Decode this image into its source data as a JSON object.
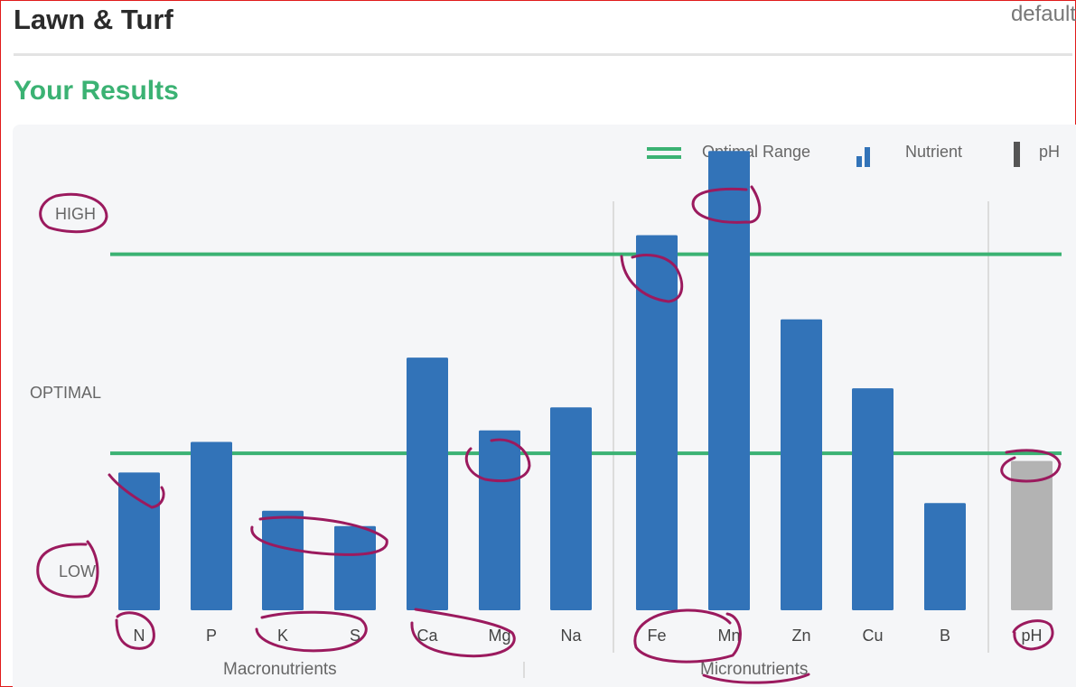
{
  "header": {
    "title": "Lawn & Turf",
    "profile": "default"
  },
  "section": {
    "title": "Your Results"
  },
  "legend": {
    "optimal": "Optimal Range",
    "nutrient": "Nutrient",
    "ph": "pH"
  },
  "levels": {
    "high": "HIGH",
    "optimal": "OPTIMAL",
    "low": "LOW"
  },
  "groups": {
    "macro": "Macronutrients",
    "micro": "Micronutrients"
  },
  "colors": {
    "nutrient": "#3273b8",
    "ph": "#b3b3b3",
    "optimal": "#3bb273",
    "annotation": "#9b1a5e"
  },
  "chart_data": {
    "type": "bar",
    "categories": [
      "N",
      "P",
      "K",
      "S",
      "Ca",
      "Mg",
      "Na",
      "Fe",
      "Mn",
      "Zn",
      "Cu",
      "B",
      "pH"
    ],
    "values": [
      0.36,
      0.44,
      0.26,
      0.22,
      0.66,
      0.47,
      0.53,
      0.98,
      1.2,
      0.76,
      0.58,
      0.28,
      0.39
    ],
    "ylim": [
      0,
      1.25
    ],
    "y_levels": [
      "LOW",
      "OPTIMAL",
      "HIGH"
    ],
    "optimal_range": [
      0.41,
      0.93
    ],
    "groups": [
      {
        "name": "Macronutrients",
        "categories": [
          "N",
          "P",
          "K",
          "S",
          "Ca",
          "Mg",
          "Na"
        ]
      },
      {
        "name": "Micronutrients",
        "categories": [
          "Fe",
          "Mn",
          "Zn",
          "Cu",
          "B"
        ]
      },
      {
        "name": "",
        "categories": [
          "pH"
        ]
      }
    ],
    "grid": false,
    "legend_position": "top-right"
  }
}
